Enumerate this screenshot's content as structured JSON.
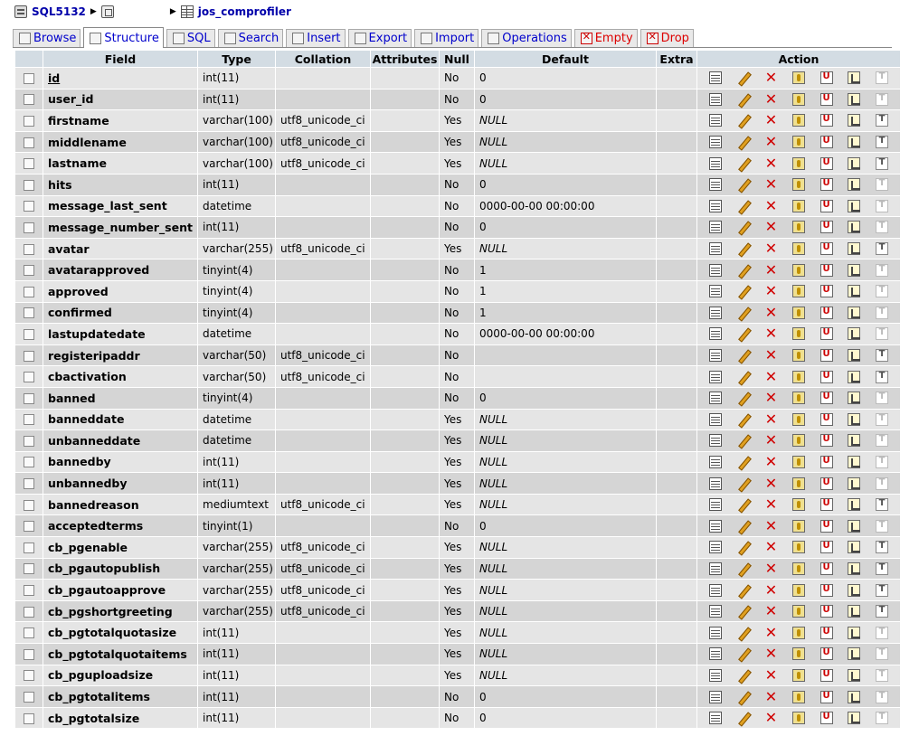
{
  "breadcrumb": {
    "server": "SQL5132",
    "table": "jos_comprofiler"
  },
  "tabs": [
    {
      "label": "Browse",
      "icon": "browse-icon",
      "active": false,
      "danger": false
    },
    {
      "label": "Structure",
      "icon": "structure-icon",
      "active": true,
      "danger": false
    },
    {
      "label": "SQL",
      "icon": "sql-icon",
      "active": false,
      "danger": false
    },
    {
      "label": "Search",
      "icon": "search-icon",
      "active": false,
      "danger": false
    },
    {
      "label": "Insert",
      "icon": "insert-icon",
      "active": false,
      "danger": false
    },
    {
      "label": "Export",
      "icon": "export-icon",
      "active": false,
      "danger": false
    },
    {
      "label": "Import",
      "icon": "import-icon",
      "active": false,
      "danger": false
    },
    {
      "label": "Operations",
      "icon": "operations-icon",
      "active": false,
      "danger": false
    },
    {
      "label": "Empty",
      "icon": "empty-icon",
      "active": false,
      "danger": true
    },
    {
      "label": "Drop",
      "icon": "drop-icon",
      "active": false,
      "danger": true
    }
  ],
  "columns": [
    "Field",
    "Type",
    "Collation",
    "Attributes",
    "Null",
    "Default",
    "Extra",
    "Action"
  ],
  "rows": [
    {
      "field": "id",
      "type": "int(11)",
      "collation": "",
      "attributes": "",
      "null": "No",
      "default": "0",
      "extra": "",
      "pk": true,
      "fulltext": false
    },
    {
      "field": "user_id",
      "type": "int(11)",
      "collation": "",
      "attributes": "",
      "null": "No",
      "default": "0",
      "extra": "",
      "pk": false,
      "fulltext": false
    },
    {
      "field": "firstname",
      "type": "varchar(100)",
      "collation": "utf8_unicode_ci",
      "attributes": "",
      "null": "Yes",
      "default": "NULL",
      "extra": "",
      "pk": false,
      "fulltext": true
    },
    {
      "field": "middlename",
      "type": "varchar(100)",
      "collation": "utf8_unicode_ci",
      "attributes": "",
      "null": "Yes",
      "default": "NULL",
      "extra": "",
      "pk": false,
      "fulltext": true
    },
    {
      "field": "lastname",
      "type": "varchar(100)",
      "collation": "utf8_unicode_ci",
      "attributes": "",
      "null": "Yes",
      "default": "NULL",
      "extra": "",
      "pk": false,
      "fulltext": true
    },
    {
      "field": "hits",
      "type": "int(11)",
      "collation": "",
      "attributes": "",
      "null": "No",
      "default": "0",
      "extra": "",
      "pk": false,
      "fulltext": false
    },
    {
      "field": "message_last_sent",
      "type": "datetime",
      "collation": "",
      "attributes": "",
      "null": "No",
      "default": "0000-00-00 00:00:00",
      "extra": "",
      "pk": false,
      "fulltext": false
    },
    {
      "field": "message_number_sent",
      "type": "int(11)",
      "collation": "",
      "attributes": "",
      "null": "No",
      "default": "0",
      "extra": "",
      "pk": false,
      "fulltext": false
    },
    {
      "field": "avatar",
      "type": "varchar(255)",
      "collation": "utf8_unicode_ci",
      "attributes": "",
      "null": "Yes",
      "default": "NULL",
      "extra": "",
      "pk": false,
      "fulltext": true
    },
    {
      "field": "avatarapproved",
      "type": "tinyint(4)",
      "collation": "",
      "attributes": "",
      "null": "No",
      "default": "1",
      "extra": "",
      "pk": false,
      "fulltext": false
    },
    {
      "field": "approved",
      "type": "tinyint(4)",
      "collation": "",
      "attributes": "",
      "null": "No",
      "default": "1",
      "extra": "",
      "pk": false,
      "fulltext": false
    },
    {
      "field": "confirmed",
      "type": "tinyint(4)",
      "collation": "",
      "attributes": "",
      "null": "No",
      "default": "1",
      "extra": "",
      "pk": false,
      "fulltext": false
    },
    {
      "field": "lastupdatedate",
      "type": "datetime",
      "collation": "",
      "attributes": "",
      "null": "No",
      "default": "0000-00-00 00:00:00",
      "extra": "",
      "pk": false,
      "fulltext": false
    },
    {
      "field": "registeripaddr",
      "type": "varchar(50)",
      "collation": "utf8_unicode_ci",
      "attributes": "",
      "null": "No",
      "default": "",
      "extra": "",
      "pk": false,
      "fulltext": true
    },
    {
      "field": "cbactivation",
      "type": "varchar(50)",
      "collation": "utf8_unicode_ci",
      "attributes": "",
      "null": "No",
      "default": "",
      "extra": "",
      "pk": false,
      "fulltext": true
    },
    {
      "field": "banned",
      "type": "tinyint(4)",
      "collation": "",
      "attributes": "",
      "null": "No",
      "default": "0",
      "extra": "",
      "pk": false,
      "fulltext": false
    },
    {
      "field": "banneddate",
      "type": "datetime",
      "collation": "",
      "attributes": "",
      "null": "Yes",
      "default": "NULL",
      "extra": "",
      "pk": false,
      "fulltext": false
    },
    {
      "field": "unbanneddate",
      "type": "datetime",
      "collation": "",
      "attributes": "",
      "null": "Yes",
      "default": "NULL",
      "extra": "",
      "pk": false,
      "fulltext": false
    },
    {
      "field": "bannedby",
      "type": "int(11)",
      "collation": "",
      "attributes": "",
      "null": "Yes",
      "default": "NULL",
      "extra": "",
      "pk": false,
      "fulltext": false
    },
    {
      "field": "unbannedby",
      "type": "int(11)",
      "collation": "",
      "attributes": "",
      "null": "Yes",
      "default": "NULL",
      "extra": "",
      "pk": false,
      "fulltext": false
    },
    {
      "field": "bannedreason",
      "type": "mediumtext",
      "collation": "utf8_unicode_ci",
      "attributes": "",
      "null": "Yes",
      "default": "NULL",
      "extra": "",
      "pk": false,
      "fulltext": true
    },
    {
      "field": "acceptedterms",
      "type": "tinyint(1)",
      "collation": "",
      "attributes": "",
      "null": "No",
      "default": "0",
      "extra": "",
      "pk": false,
      "fulltext": false
    },
    {
      "field": "cb_pgenable",
      "type": "varchar(255)",
      "collation": "utf8_unicode_ci",
      "attributes": "",
      "null": "Yes",
      "default": "NULL",
      "extra": "",
      "pk": false,
      "fulltext": true
    },
    {
      "field": "cb_pgautopublish",
      "type": "varchar(255)",
      "collation": "utf8_unicode_ci",
      "attributes": "",
      "null": "Yes",
      "default": "NULL",
      "extra": "",
      "pk": false,
      "fulltext": true
    },
    {
      "field": "cb_pgautoapprove",
      "type": "varchar(255)",
      "collation": "utf8_unicode_ci",
      "attributes": "",
      "null": "Yes",
      "default": "NULL",
      "extra": "",
      "pk": false,
      "fulltext": true
    },
    {
      "field": "cb_pgshortgreeting",
      "type": "varchar(255)",
      "collation": "utf8_unicode_ci",
      "attributes": "",
      "null": "Yes",
      "default": "NULL",
      "extra": "",
      "pk": false,
      "fulltext": true
    },
    {
      "field": "cb_pgtotalquotasize",
      "type": "int(11)",
      "collation": "",
      "attributes": "",
      "null": "Yes",
      "default": "NULL",
      "extra": "",
      "pk": false,
      "fulltext": false
    },
    {
      "field": "cb_pgtotalquotaitems",
      "type": "int(11)",
      "collation": "",
      "attributes": "",
      "null": "Yes",
      "default": "NULL",
      "extra": "",
      "pk": false,
      "fulltext": false
    },
    {
      "field": "cb_pguploadsize",
      "type": "int(11)",
      "collation": "",
      "attributes": "",
      "null": "Yes",
      "default": "NULL",
      "extra": "",
      "pk": false,
      "fulltext": false
    },
    {
      "field": "cb_pgtotalitems",
      "type": "int(11)",
      "collation": "",
      "attributes": "",
      "null": "No",
      "default": "0",
      "extra": "",
      "pk": false,
      "fulltext": false
    },
    {
      "field": "cb_pgtotalsize",
      "type": "int(11)",
      "collation": "",
      "attributes": "",
      "null": "No",
      "default": "0",
      "extra": "",
      "pk": false,
      "fulltext": false
    }
  ],
  "action_icons": [
    "browse-distinct-icon",
    "edit-icon",
    "drop-icon",
    "primary-key-icon",
    "unique-icon",
    "index-icon",
    "fulltext-icon"
  ]
}
